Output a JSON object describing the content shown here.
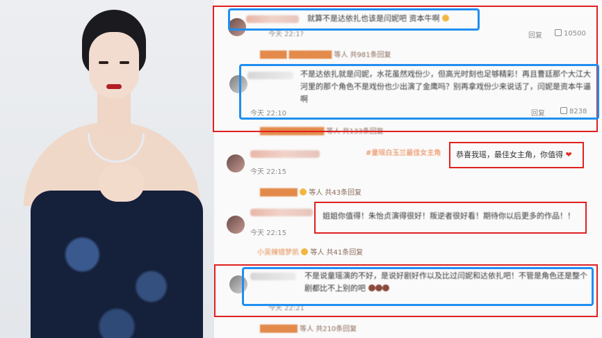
{
  "photo": {
    "alt": "portrait"
  },
  "comments": {
    "c1": {
      "text": "就算不是达依扎也该是闫妮吧 资本牛啊",
      "time": "今天 22:1?",
      "reply_label": "回复",
      "likes": "10500",
      "replies_summary_suffix": "等人 共981条回复"
    },
    "c1_reply": {
      "text": "不是达依扎就是闫妮，水花虽然戏份少，但高光时刻也足够精彩！再且曹廷那个大江大河里的那个角色不是戏份也少出演了金鹰吗？别再拿戏份少来说话了，闫妮是资本牛逼啊",
      "time": "今天 22:10",
      "reply_label": "回复",
      "likes": "8238"
    },
    "c1_more": "等人 共133条回复",
    "c2": {
      "topic": "#童瑶白玉兰最佳女主角",
      "text": "恭喜我瑶，最佳女主角，你值得",
      "time": "今天 22:15",
      "replies_summary": "等人 共43条回复"
    },
    "c3": {
      "text": "姐姐你值得！朱怡贞演得很好！叛逆者很好看！期待你以后更多的作品！！",
      "time": "今天 22:15",
      "replies_prefix": "小吴辣错梦凯",
      "replies_summary": "等人 共41条回复"
    },
    "c4": {
      "text": "不是说童瑶演的不好，是说好剧好作以及比过闫妮和达依扎吧！不管是角色还是整个剧都比不上别的吧",
      "time": "今天 22:21",
      "replies_summary": "等人 共210条回复"
    }
  },
  "colors": {
    "red_box": "#e02020",
    "blue_box": "#1f8ef1"
  }
}
